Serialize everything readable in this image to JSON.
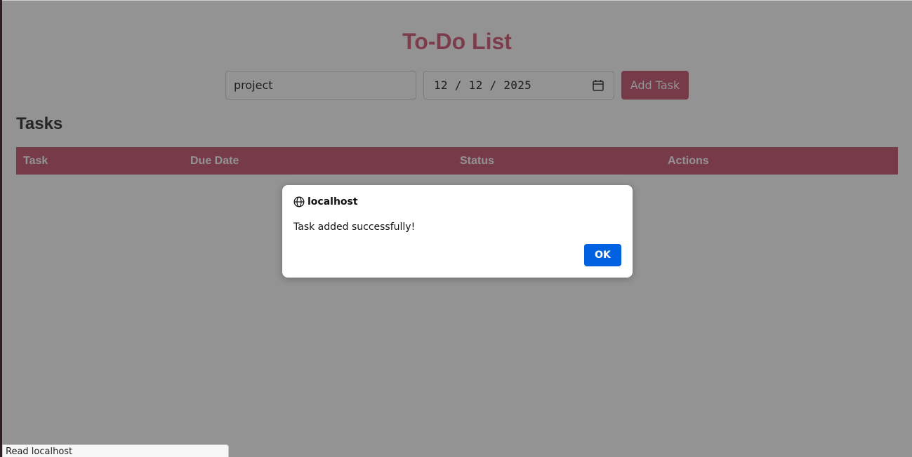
{
  "page": {
    "title": "To-Do List"
  },
  "form": {
    "task_value": "project",
    "date_value": "12 / 12 / 2025",
    "add_label": "Add Task"
  },
  "tasks": {
    "heading": "Tasks",
    "columns": [
      "Task",
      "Due Date",
      "Status",
      "Actions"
    ]
  },
  "dialog": {
    "origin": "localhost",
    "message": "Task added successfully!",
    "ok_label": "OK"
  },
  "status_bar": {
    "text": "Read localhost"
  },
  "colors": {
    "accent": "#c44d6a",
    "title": "#d2506e",
    "dialog_button": "#0062e0"
  },
  "icons": {
    "date_picker": "calendar-icon",
    "dialog_origin": "globe-icon"
  }
}
